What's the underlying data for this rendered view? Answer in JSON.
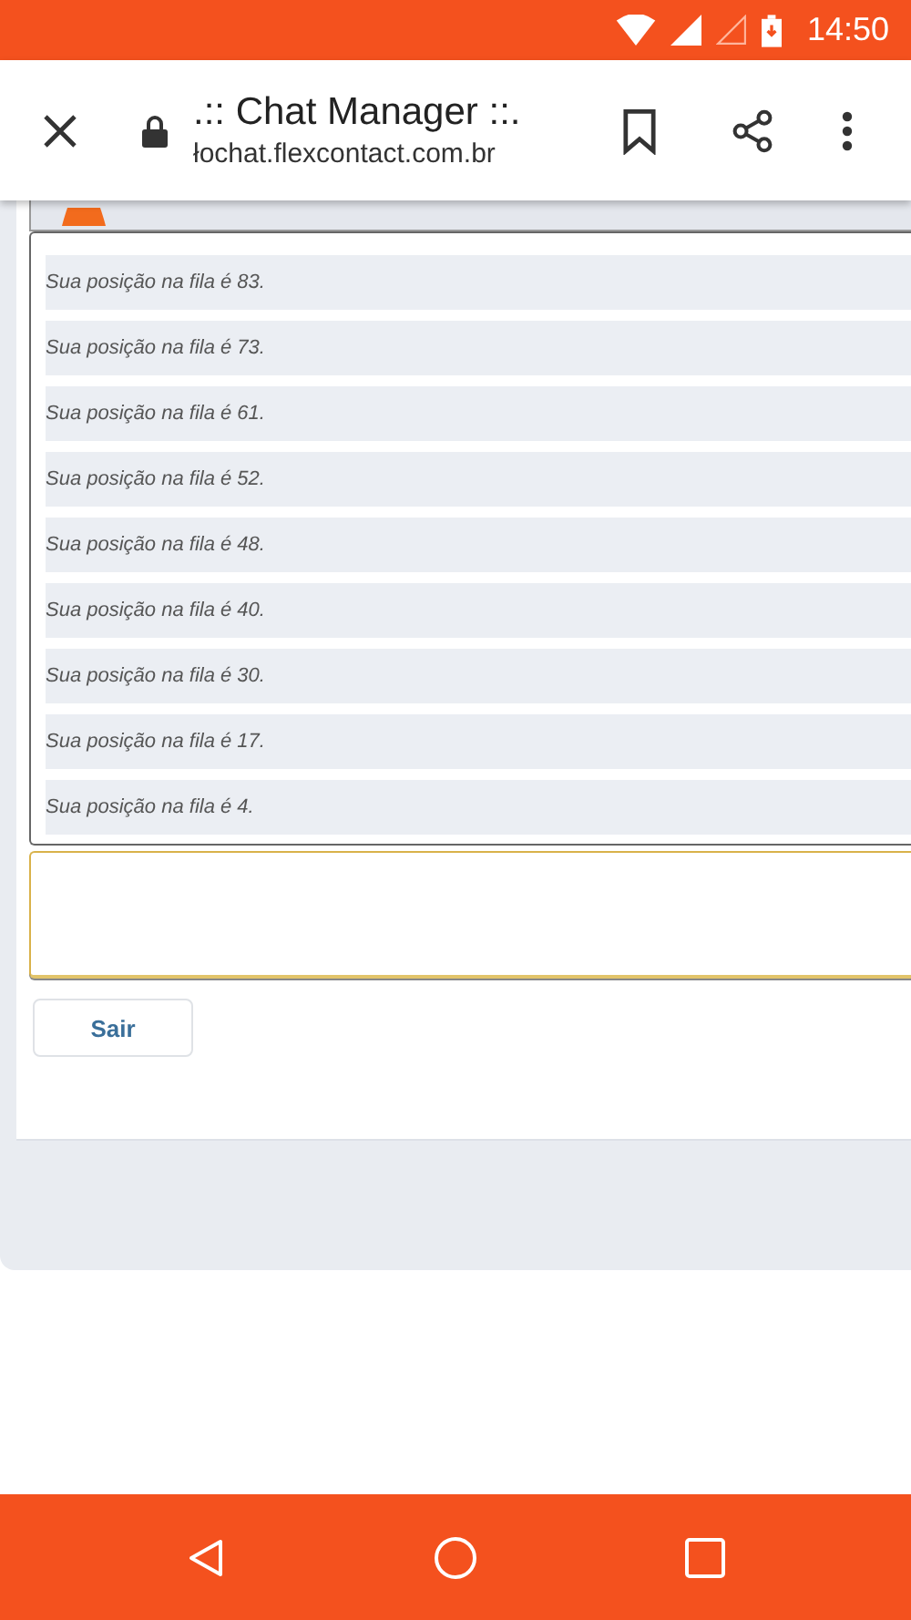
{
  "status_bar": {
    "time": "14:50"
  },
  "browser": {
    "title": ".:: Chat Manager ::.",
    "url": "łochat.flexcontact.com.br"
  },
  "messages": [
    {
      "text": "Sua posição na fila é 83."
    },
    {
      "text": "Sua posição na fila é 73."
    },
    {
      "text": "Sua posição na fila é 61."
    },
    {
      "text": "Sua posição na fila é 52."
    },
    {
      "text": "Sua posição na fila é 48."
    },
    {
      "text": "Sua posição na fila é 40."
    },
    {
      "text": "Sua posição na fila é 30."
    },
    {
      "text": "Sua posição na fila é 17."
    },
    {
      "text": "Sua posição na fila é 4."
    }
  ],
  "buttons": [
    {
      "label": "Sair"
    }
  ]
}
